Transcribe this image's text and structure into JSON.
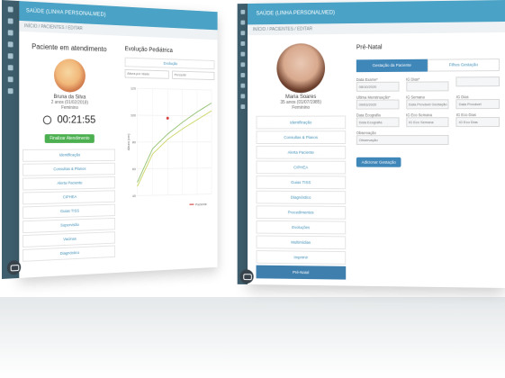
{
  "back_screen": {
    "app_title": "SAÚDE (LINHA PERSONALMED)",
    "breadcrumb": "INÍCIO / PACIENTES / EDITAR",
    "left_panel": {
      "title": "Paciente em atendimento",
      "name": "Bruna da Silva",
      "age": "2 anos (01/02/2018)",
      "status": "Feminino",
      "timer": "00:21:55",
      "finalize_button": "Finalizar Atendimento",
      "menu": [
        "Identificação",
        "Consultas & Planos",
        "Alerta Paciente",
        "CIPHEA",
        "Guias TISS",
        "Supervisão",
        "Vacinas",
        "Diagnóstico"
      ]
    },
    "right_panel": {
      "title": "Evolução Pediátrica",
      "tab": "Evolução",
      "select_left": "Altura por Idade",
      "select_right": "Percentil",
      "chart_data": {
        "type": "line",
        "title": "",
        "ylabel": "Altura (cm)",
        "ylim": [
          40,
          120
        ],
        "yticks": [
          40,
          60,
          80,
          100,
          120
        ],
        "x": [
          0,
          1,
          2,
          3,
          4,
          5
        ],
        "series": [
          {
            "values": [
              50,
              75,
              86,
              95,
              103,
              110
            ]
          },
          {
            "values": [
              47,
              71,
              82,
              90,
              97,
              104
            ]
          }
        ],
        "point": {
          "x": 2,
          "y": 98
        },
        "legend": "Paciente"
      }
    }
  },
  "front_screen": {
    "app_title": "SAÚDE (LINHA PERSONALMED)",
    "breadcrumb": "INÍCIO / PACIENTES / EDITAR",
    "patient": {
      "name": "Maria Soares",
      "age": "35 anos (01/07/1985)",
      "status": "Feminino"
    },
    "menu": [
      "Identificação",
      "Consultas & Planos",
      "Alerta Paciente",
      "CIPHEA",
      "Guias TISS",
      "Diagnóstico",
      "Procedimentos",
      "Evoluções",
      "Multimídias",
      "Imprimir",
      "Pré-Natal"
    ],
    "active_menu": "Pré-Natal",
    "right": {
      "title": "Pré-Natal",
      "tabs": [
        "Gestação da Paciente",
        "Filhos Gestação"
      ],
      "fields": [
        {
          "label": "Data Exame*",
          "value": "08/10/2020"
        },
        {
          "label": "IG Dias*",
          "value": ""
        },
        {
          "label": "",
          "value": ""
        },
        {
          "label": "Ultima Menstruação*",
          "value": "09/03/2020"
        },
        {
          "label": "IG Semana",
          "value": "Data Provável Gestação"
        },
        {
          "label": "IG Dias",
          "value": "Data Provável"
        },
        {
          "label": "Data Ecografia",
          "value": "Data Ecografia"
        },
        {
          "label": "IG Eco Semana",
          "value": "IG Eco Semana"
        },
        {
          "label": "IG Eco Dias",
          "value": "IG Eco Dias"
        },
        {
          "label": "Observação",
          "value": "Observação"
        }
      ],
      "save_button": "Adicionar Gestação"
    }
  }
}
